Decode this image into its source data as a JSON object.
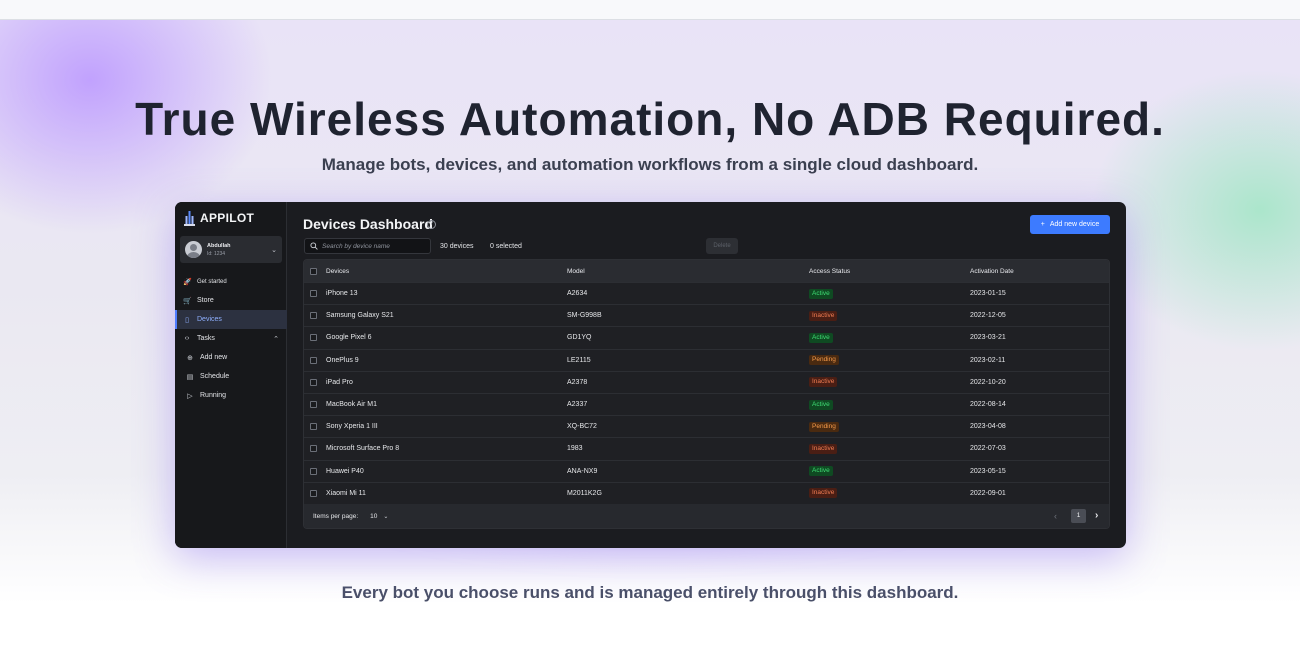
{
  "hero": {
    "title": "True Wireless Automation, No ADB Required.",
    "subtitle": "Manage bots, devices, and automation workflows from a single cloud dashboard.",
    "footer": "Every bot you choose runs and is managed entirely through this dashboard."
  },
  "app": {
    "brand": "APPILOT",
    "user": {
      "name": "Abdullah",
      "id": "Id: 1234"
    },
    "nav": [
      {
        "label": "Get started",
        "icon": "rocket-icon"
      },
      {
        "label": "Store",
        "icon": "cart-icon"
      },
      {
        "label": "Devices",
        "icon": "phone-icon",
        "active": true
      },
      {
        "label": "Tasks",
        "icon": "code-icon"
      },
      {
        "label": "Add new",
        "icon": "plus-circle-icon"
      },
      {
        "label": "Schedule",
        "icon": "calendar-icon"
      },
      {
        "label": "Running",
        "icon": "play-icon"
      }
    ],
    "page_title": "Devices Dashboard",
    "add_button": "Add new device",
    "search_placeholder": "Search by device name",
    "device_count": "30 devices",
    "selected_count": "0 selected",
    "delete_button": "Delete",
    "columns": [
      "Devices",
      "Model",
      "Access Status",
      "Activation Date"
    ],
    "rows": [
      {
        "device": "iPhone 13",
        "model": "A2634",
        "status": "Active",
        "date": "2023-01-15"
      },
      {
        "device": "Samsung Galaxy S21",
        "model": "SM-G998B",
        "status": "Inactive",
        "date": "2022-12-05"
      },
      {
        "device": "Google Pixel 6",
        "model": "GD1YQ",
        "status": "Active",
        "date": "2023-03-21"
      },
      {
        "device": "OnePlus 9",
        "model": "LE2115",
        "status": "Pending",
        "date": "2023-02-11"
      },
      {
        "device": "iPad Pro",
        "model": "A2378",
        "status": "Inactive",
        "date": "2022-10-20"
      },
      {
        "device": "MacBook Air M1",
        "model": "A2337",
        "status": "Active",
        "date": "2022-08-14"
      },
      {
        "device": "Sony Xperia 1 III",
        "model": "XQ-BC72",
        "status": "Pending",
        "date": "2023-04-08"
      },
      {
        "device": "Microsoft Surface Pro 8",
        "model": "1983",
        "status": "Inactive",
        "date": "2022-07-03"
      },
      {
        "device": "Huawei P40",
        "model": "ANA-NX9",
        "status": "Active",
        "date": "2023-05-15"
      },
      {
        "device": "Xiaomi Mi 11",
        "model": "M2011K2G",
        "status": "Inactive",
        "date": "2022-09-01"
      }
    ],
    "pagination": {
      "items_per_page_label": "Items per page:",
      "items_per_page": "10",
      "current_page": "1"
    },
    "colors": {
      "accent": "#3d7bff",
      "active": "#3fdc74",
      "inactive": "#f07d53",
      "pending": "#f59a4a"
    }
  }
}
